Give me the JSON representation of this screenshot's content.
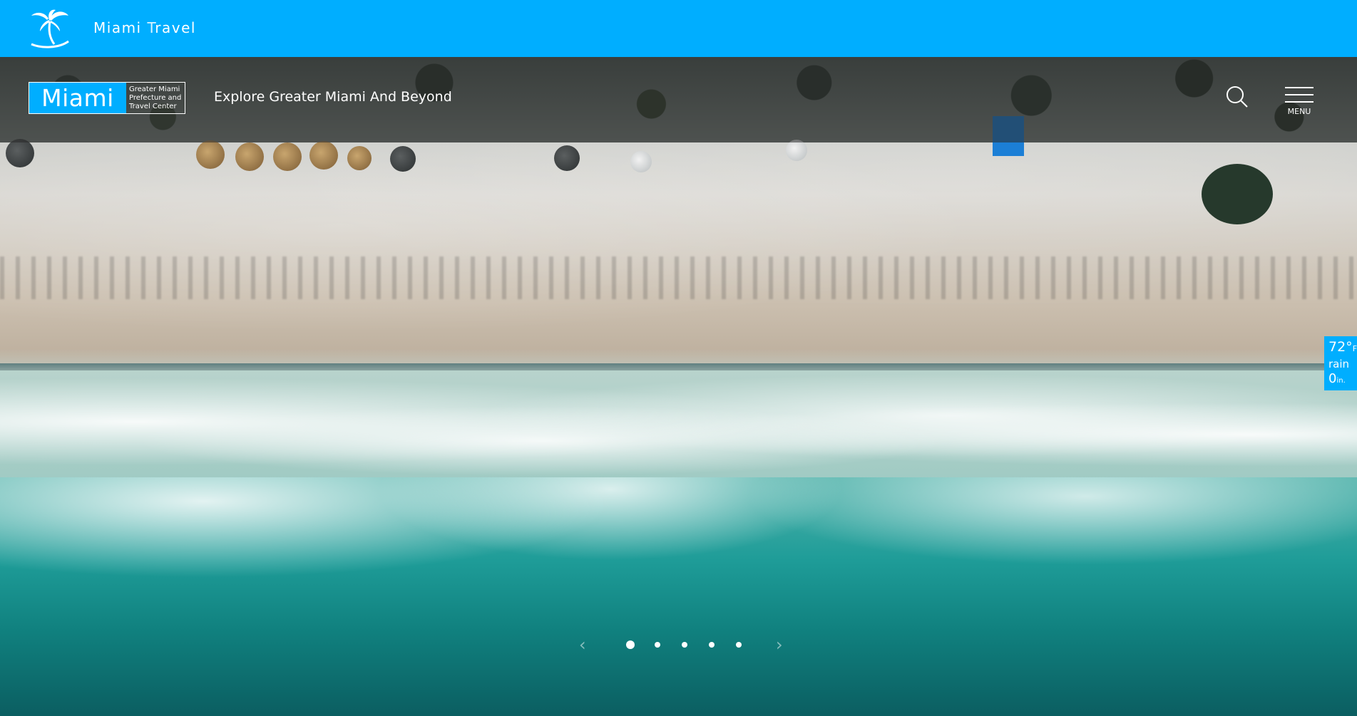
{
  "site": {
    "name_prefix": "Miami ",
    "name_t": "T",
    "name_rest": "ravel"
  },
  "brand_logo": {
    "main": "Miami",
    "sub_line1": "Greater Miami",
    "sub_line2": "Prefecture and",
    "sub_line3": "Travel Center"
  },
  "tagline": "Explore Greater Miami And Beyond",
  "menu": {
    "label": "MENU"
  },
  "weather": {
    "temp": "72°",
    "unit": "F",
    "condition": "rain",
    "amount": "0",
    "amount_unit": "in."
  },
  "slider": {
    "slide_count": 5,
    "active_index": 0
  },
  "colors": {
    "accent": "#00aeff",
    "nav_overlay": "rgba(40,40,40,0.55)"
  },
  "icons": [
    "palm-tree-icon",
    "search-icon",
    "hamburger-menu-icon",
    "chevron-left-icon",
    "chevron-right-icon"
  ]
}
